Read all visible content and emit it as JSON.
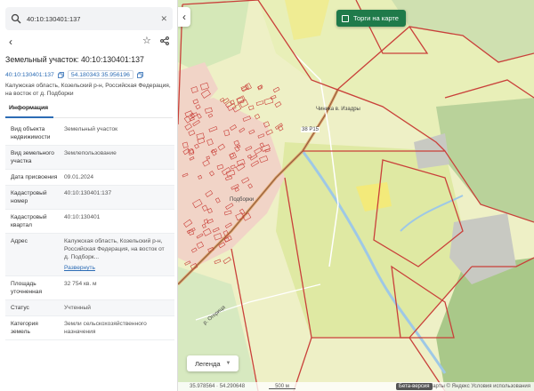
{
  "search": {
    "value": "40:10:130401:137"
  },
  "card": {
    "title": "Земельный участок: 40:10:130401:137",
    "cadastral_id": "40:10:130401:137",
    "coordinates": "54.180343 35.956196",
    "address": "Калужская область, Козельский р-н, Российская Федерация, на восток от д. Подборки",
    "tab_info": "Информация"
  },
  "details": [
    {
      "label": "Вид объекта недвижимости",
      "value": "Земельный участок"
    },
    {
      "label": "Вид земельного участка",
      "value": "Землепользование"
    },
    {
      "label": "Дата присвоения",
      "value": "09.01.2024"
    },
    {
      "label": "Кадастровый номер",
      "value": "40:10:130401:137"
    },
    {
      "label": "Кадастровый квартал",
      "value": "40:10:130401"
    },
    {
      "label": "Адрес",
      "value": "Калужская область, Козельский р-н, Российская Федерация, на восток от д. Подборк...",
      "more": "Развернуть"
    },
    {
      "label": "Площадь уточненная",
      "value": "32 754 кв. м"
    },
    {
      "label": "Статус",
      "value": "Учтенный"
    },
    {
      "label": "Категория земель",
      "value": "Земли сельскохозяйственного назначения"
    }
  ],
  "map": {
    "torgi_label": "Торги на карте",
    "legend_label": "Легенда",
    "labels": {
      "village": "Чиника в. Изадры",
      "road": "38 Р15",
      "podborki": "Подборки",
      "river": "р. Огорица",
      "mouse_coords": "35.978564 · 54.290648",
      "scale": "500 м",
      "beta": "Бета-версия",
      "attribution": "Карты © Яндекс  Условия использования"
    }
  },
  "colors": {
    "accent": "#2c6cb5",
    "torgi_bg": "#1f7a4a",
    "parcel_red": "#c9403a"
  }
}
